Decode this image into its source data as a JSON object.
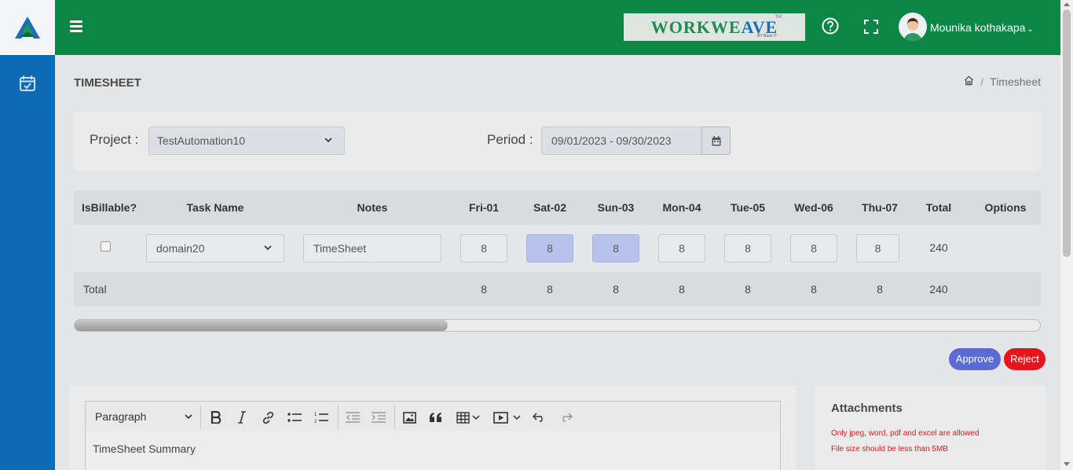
{
  "header": {
    "brand_name_part1": "WORKWE",
    "brand_name_part2": "AVE",
    "brand_tm": "TM",
    "brand_sub": "BY Bask IT",
    "user_name": "Mounika kothakapa"
  },
  "page": {
    "title": "TIMESHEET",
    "breadcrumb": [
      "Timesheet"
    ]
  },
  "filters": {
    "project_label": "Project :",
    "project_value": "TestAutomation10",
    "period_label": "Period :",
    "period_value": "09/01/2023 - 09/30/2023"
  },
  "table": {
    "headers": [
      "IsBillable?",
      "Task Name",
      "Notes",
      "Fri-01",
      "Sat-02",
      "Sun-03",
      "Mon-04",
      "Tue-05",
      "Wed-06",
      "Thu-07",
      "Total",
      "Options"
    ],
    "row": {
      "task": "domain20",
      "notes": "TimeSheet",
      "hours": [
        "8",
        "8",
        "8",
        "8",
        "8",
        "8",
        "8"
      ],
      "total": "240"
    },
    "total_row": {
      "label": "Total",
      "hours": [
        "8",
        "8",
        "8",
        "8",
        "8",
        "8",
        "8"
      ],
      "total": "240"
    },
    "scroll_position_fraction": 0.0
  },
  "actions": {
    "approve": "Approve",
    "reject": "Reject"
  },
  "editor": {
    "block_style": "Paragraph",
    "content": "TimeSheet Summary"
  },
  "attachments": {
    "title": "Attachments",
    "note1": "Only jpeg, word, pdf and excel are allowed",
    "note2": "File size should be less than 5MB"
  },
  "colors": {
    "topbar": "#0b8645",
    "sidebar": "#0d6ab4",
    "approve": "#5b6bd6",
    "reject": "#e8141b",
    "highlighted_cell": "#b8c2ea"
  }
}
